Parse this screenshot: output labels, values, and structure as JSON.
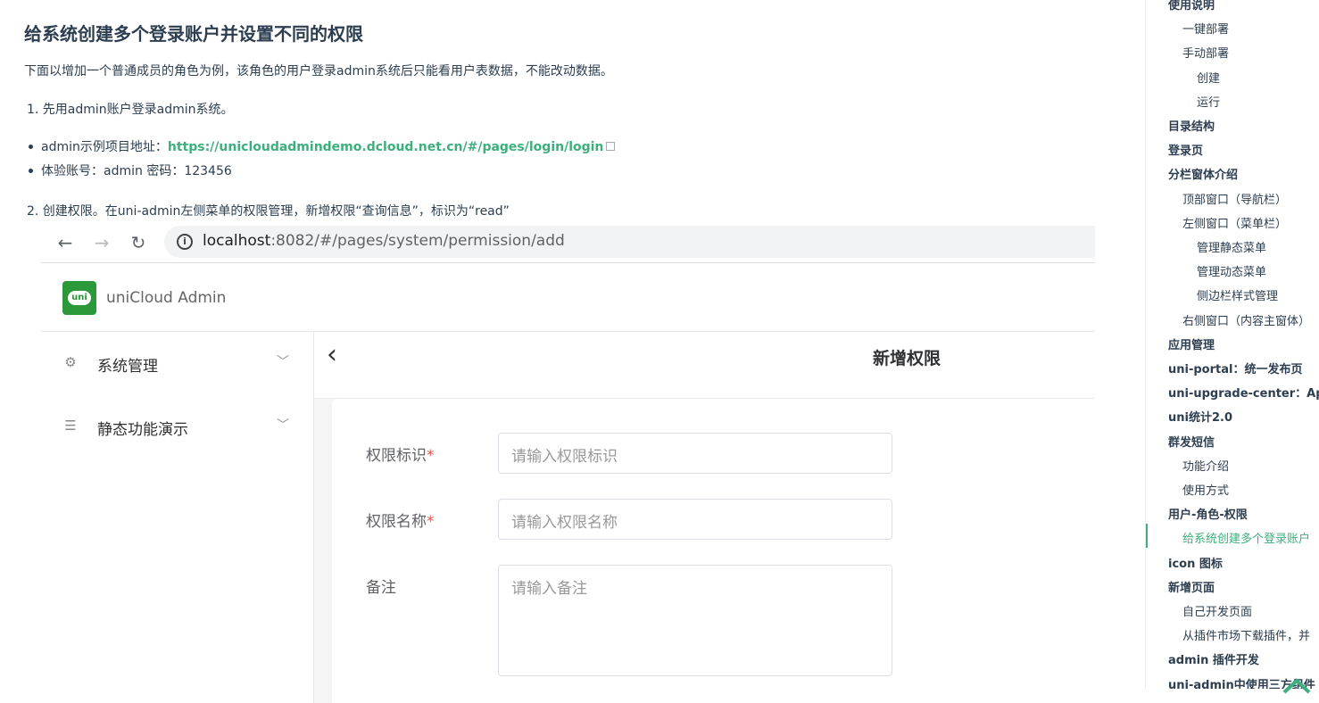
{
  "article": {
    "heading": "给系统创建多个登录账户并设置不同的权限",
    "intro": "下面以增加一个普通成员的角色为例，该角色的用户登录admin系统后只能看用户表数据，不能改动数据。",
    "step1": "1. 先用admin账户登录admin系统。",
    "bullet1_prefix": "admin示例项目地址：",
    "bullet1_link": "https://unicloudadmindemo.dcloud.net.cn/#/pages/login/login",
    "bullet2": "体验账号：admin 密码：123456",
    "step2": "2. 创建权限。在uni-admin左侧菜单的权限管理，新增权限“查询信息”，标识为“read”"
  },
  "browser": {
    "back_icon": "arrow-left-icon",
    "forward_icon": "arrow-right-icon",
    "reload_icon": "reload-icon",
    "url_host": "localhost",
    "url_rest": ":8082/#/pages/system/permission/add"
  },
  "app": {
    "logo_text": "uni",
    "name": "uniCloud Admin",
    "menu": [
      {
        "label": "系统管理",
        "icon": "gear-icon"
      },
      {
        "label": "静态功能演示",
        "icon": "list-icon"
      }
    ],
    "page_title": "新增权限",
    "form": {
      "fields": [
        {
          "label": "权限标识",
          "required": "*",
          "placeholder": "请输入权限标识"
        },
        {
          "label": "权限名称",
          "required": "*",
          "placeholder": "请输入权限名称"
        },
        {
          "label": "备注",
          "required": "",
          "placeholder": "请输入备注"
        }
      ]
    }
  },
  "toc": {
    "items": [
      {
        "label": "使用说明",
        "level": 1
      },
      {
        "label": "一键部署",
        "level": 2
      },
      {
        "label": "手动部署",
        "level": 2
      },
      {
        "label": "创建",
        "level": 3
      },
      {
        "label": "运行",
        "level": 3
      },
      {
        "label": "目录结构",
        "level": 1
      },
      {
        "label": "登录页",
        "level": 1
      },
      {
        "label": "分栏窗体介绍",
        "level": 1
      },
      {
        "label": "顶部窗口（导航栏）",
        "level": 2
      },
      {
        "label": "左侧窗口（菜单栏）",
        "level": 2
      },
      {
        "label": "管理静态菜单",
        "level": 3
      },
      {
        "label": "管理动态菜单",
        "level": 3
      },
      {
        "label": "侧边栏样式管理",
        "level": 3
      },
      {
        "label": "右侧窗口（内容主窗体）",
        "level": 2
      },
      {
        "label": "应用管理",
        "level": 1
      },
      {
        "label": "uni-portal：统一发布页",
        "level": 1
      },
      {
        "label": "uni-upgrade-center：App",
        "level": 1
      },
      {
        "label": "uni统计2.0",
        "level": 1
      },
      {
        "label": "群发短信",
        "level": 1
      },
      {
        "label": "功能介绍",
        "level": 2
      },
      {
        "label": "使用方式",
        "level": 2
      },
      {
        "label": "用户-角色-权限",
        "level": 1
      },
      {
        "label": "给系统创建多个登录账户",
        "level": 2,
        "active": true
      },
      {
        "label": "icon 图标",
        "level": 1
      },
      {
        "label": "新增页面",
        "level": 1
      },
      {
        "label": "自己开发页面",
        "level": 2
      },
      {
        "label": "从插件市场下载插件，并",
        "level": 2
      },
      {
        "label": "admin 插件开发",
        "level": 1
      },
      {
        "label": "uni-admin中使用三方组件",
        "level": 1
      }
    ],
    "back_to_top_icon": "chevron-up-icon"
  },
  "colors": {
    "accent": "#3eaf7c",
    "logo_green": "#2b9939",
    "required_red": "#dd524d"
  }
}
